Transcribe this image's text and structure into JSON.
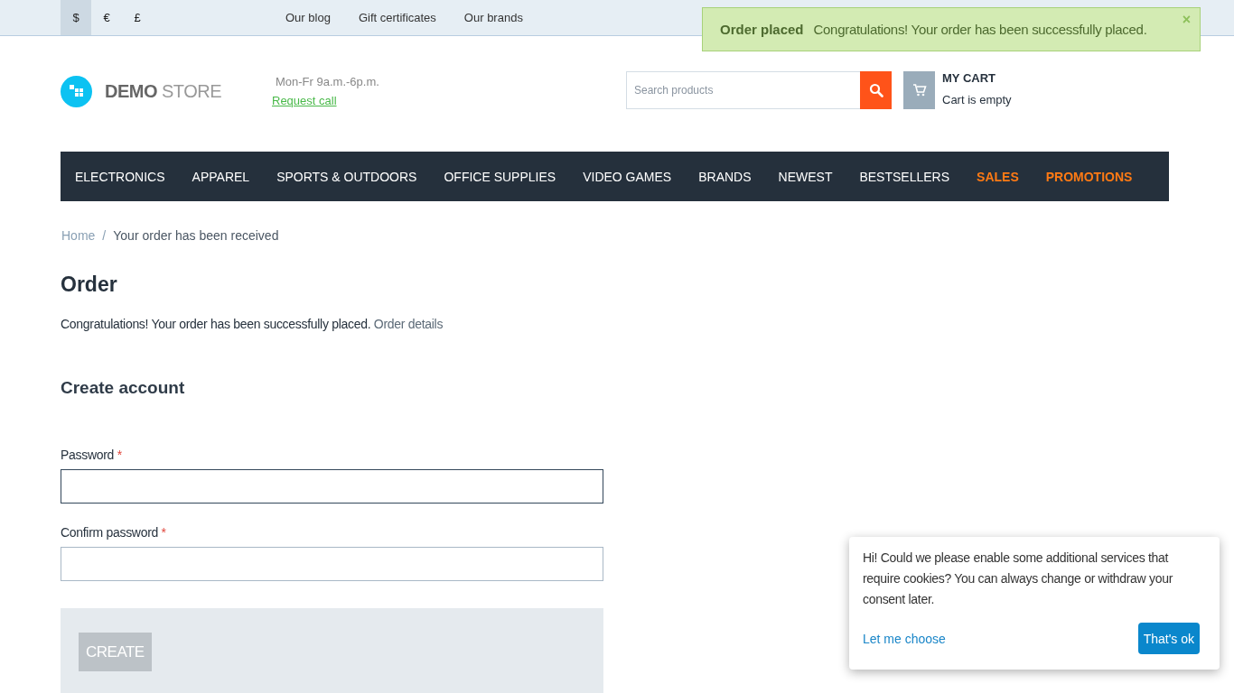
{
  "topbar": {
    "currencies": [
      {
        "label": "$",
        "selected": true
      },
      {
        "label": "€",
        "selected": false
      },
      {
        "label": "£",
        "selected": false
      }
    ],
    "links": [
      "Our blog",
      "Gift certificates",
      "Our brands"
    ]
  },
  "notification": {
    "title": "Order placed",
    "message": "Congratulations! Your order has been successfully placed.",
    "close": "×"
  },
  "header": {
    "logo_bold": "DEMO",
    "logo_light": "STORE",
    "hours": "Mon-Fr 9a.m.-6p.m.",
    "request_call": "Request call",
    "search": {
      "placeholder": "Search products"
    },
    "cart": {
      "title": "MY CART",
      "status": "Cart is empty"
    }
  },
  "menu": [
    {
      "label": "ELECTRONICS",
      "kind": "normal"
    },
    {
      "label": "APPAREL",
      "kind": "normal"
    },
    {
      "label": "SPORTS & OUTDOORS",
      "kind": "normal"
    },
    {
      "label": "OFFICE SUPPLIES",
      "kind": "normal"
    },
    {
      "label": "VIDEO GAMES",
      "kind": "normal"
    },
    {
      "label": "BRANDS",
      "kind": "normal"
    },
    {
      "label": "NEWEST",
      "kind": "normal"
    },
    {
      "label": "BESTSELLERS",
      "kind": "normal"
    },
    {
      "label": "SALES",
      "kind": "promo"
    },
    {
      "label": "PROMOTIONS",
      "kind": "promo"
    }
  ],
  "breadcrumb": [
    "Home",
    "Your order has been received"
  ],
  "breadcrumb_separator": "/",
  "page": {
    "title": "Order",
    "message": "Congratulations! Your order has been successfully placed.",
    "details_link": "Order details",
    "form": {
      "title": "Create account",
      "required_mark": "*",
      "fields": [
        {
          "label": "Password",
          "required": true
        },
        {
          "label": "Confirm password",
          "required": true
        }
      ],
      "button": {
        "label": "CREATE",
        "disabled": true
      }
    }
  },
  "cookie": {
    "text": "Hi! Could we please enable some additional services that require cookies? You can always change or withdraw your consent later.",
    "choose": "Let me choose",
    "accept": "That's ok"
  }
}
